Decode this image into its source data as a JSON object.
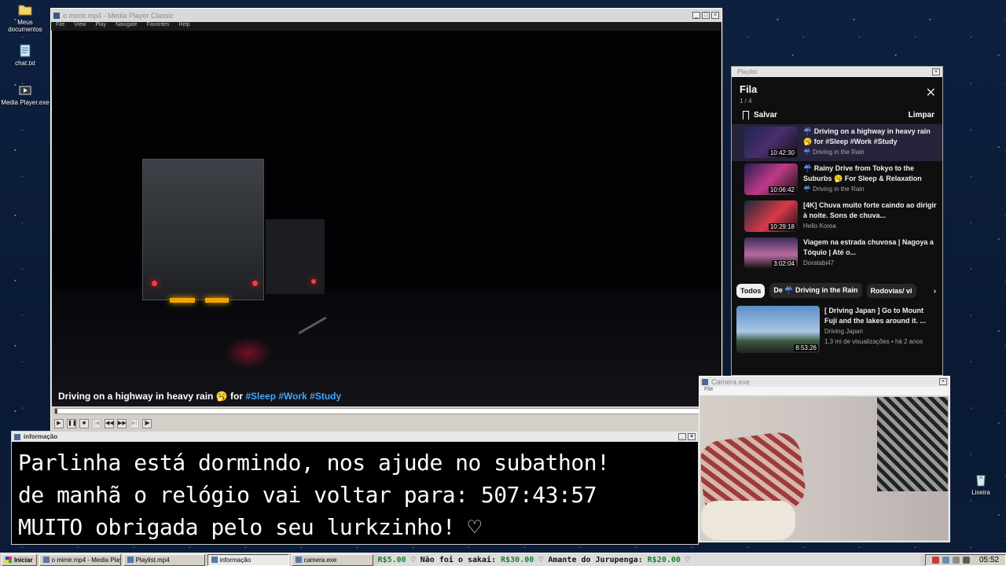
{
  "desktop": {
    "icons": [
      {
        "label": "Meus documentos",
        "icon": "folder-icon"
      },
      {
        "label": "chat.txt",
        "icon": "notepad-icon"
      },
      {
        "label": "Media Player.exe",
        "icon": "media-player-icon"
      },
      {
        "label": "Lixeira",
        "icon": "recycle-bin-icon"
      }
    ]
  },
  "mpc": {
    "title": "o mimir.mp4 - Media Player Classic",
    "menu": [
      "File",
      "View",
      "Play",
      "Navigate",
      "Favorites",
      "Help"
    ],
    "caption_title": "Driving on a highway in heavy rain 🥱 for",
    "caption_tags": "#Sleep #Work #Study"
  },
  "playlist": {
    "window_title": "Playlist",
    "heading": "Fila",
    "count": "1 / 4",
    "save": "Salvar",
    "clear": "Limpar",
    "items": [
      {
        "title": "☔ Driving on a highway in heavy rain 🥱 for #Sleep #Work #Study",
        "channel": "☔ Driving in the Rain",
        "duration": "10:42:30"
      },
      {
        "title": "☔ Rainy Drive from Tokyo to the Suburbs 🥱 For Sleep & Relaxation",
        "channel": "☔ Driving in the Rain",
        "duration": "10:06:42"
      },
      {
        "title": "[4K] Chuva muito forte caindo ao dirigir à noite. Sons de chuva...",
        "channel": "Hello Korea",
        "duration": "10:29:18"
      },
      {
        "title": "Viagem na estrada chuvosa | Nagoya a Tóquio | Até o...",
        "channel": "Doratabi47",
        "duration": "3:02:04"
      }
    ],
    "chips": [
      "Todos",
      "De ☔ Driving in the Rain",
      "Rodovias/ vi"
    ],
    "recommended": {
      "title": "[ Driving Japan ] Go to Mount Fuji and the lakes around it. ...",
      "channel": "Driving Japan",
      "meta": "1,3 mi de visualizações • há 2 anos",
      "duration": "8:53:26"
    }
  },
  "camera": {
    "title": "Camera.exe",
    "menu": "File"
  },
  "info": {
    "title": "informação",
    "lines": [
      "Parlinha está dormindo, nos ajude no subathon!",
      "de manhã o relógio vai voltar para:  507:43:57",
      "MUITO obrigada pelo seu lurkzinho! ♡"
    ]
  },
  "taskbar": {
    "start": "Iniciar",
    "tasks": [
      {
        "label": "o mimir.mp4 - Media Player..."
      },
      {
        "label": "Playlist.mp4"
      },
      {
        "label": "informação"
      },
      {
        "label": "camera.exe"
      }
    ],
    "ticker": [
      {
        "amount": "R$5.00",
        "text": " ♡  Não foi o sakai: "
      },
      {
        "amount": "R$30.00",
        "text": " ♡  Amante do Jurupenga: "
      },
      {
        "amount": "R$20.00",
        "text": " ♡"
      }
    ],
    "clock": "05:52"
  }
}
